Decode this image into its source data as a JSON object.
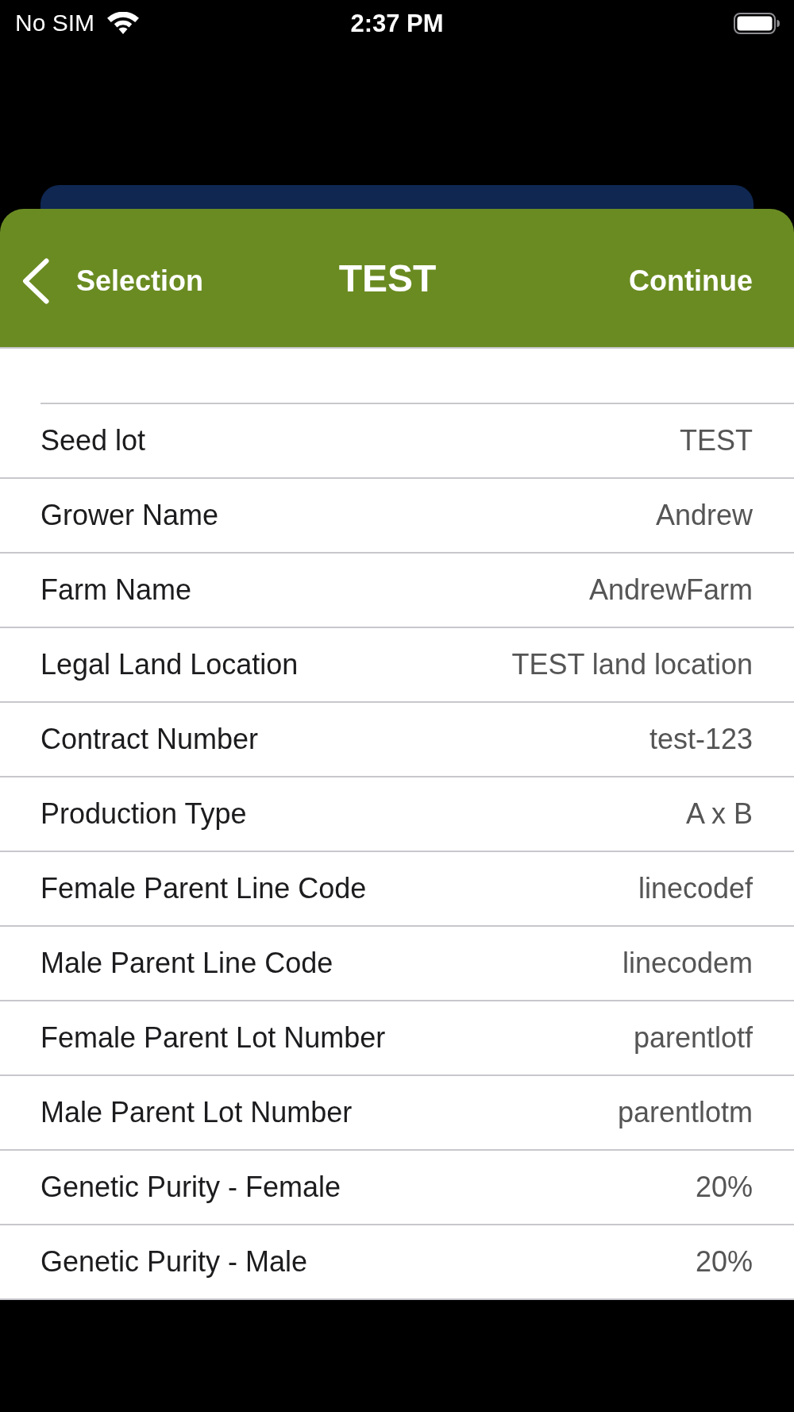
{
  "status_bar": {
    "carrier": "No SIM",
    "time": "2:37 PM"
  },
  "nav_bar": {
    "back_button": "Selection",
    "title": "TEST",
    "action_button": "Continue"
  },
  "details": [
    {
      "label": "Seed lot",
      "value": "TEST"
    },
    {
      "label": "Grower Name",
      "value": "Andrew"
    },
    {
      "label": "Farm Name",
      "value": "AndrewFarm"
    },
    {
      "label": "Legal Land Location",
      "value": "TEST land location"
    },
    {
      "label": "Contract Number",
      "value": "test-123"
    },
    {
      "label": "Production Type",
      "value": "A x B"
    },
    {
      "label": "Female Parent Line Code",
      "value": "linecodef"
    },
    {
      "label": "Male Parent Line Code",
      "value": "linecodem"
    },
    {
      "label": "Female Parent Lot Number",
      "value": "parentlotf"
    },
    {
      "label": "Male Parent Lot Number",
      "value": "parentlotm"
    },
    {
      "label": "Genetic Purity - Female",
      "value": "20%"
    },
    {
      "label": "Genetic Purity - Male",
      "value": "20%"
    }
  ]
}
